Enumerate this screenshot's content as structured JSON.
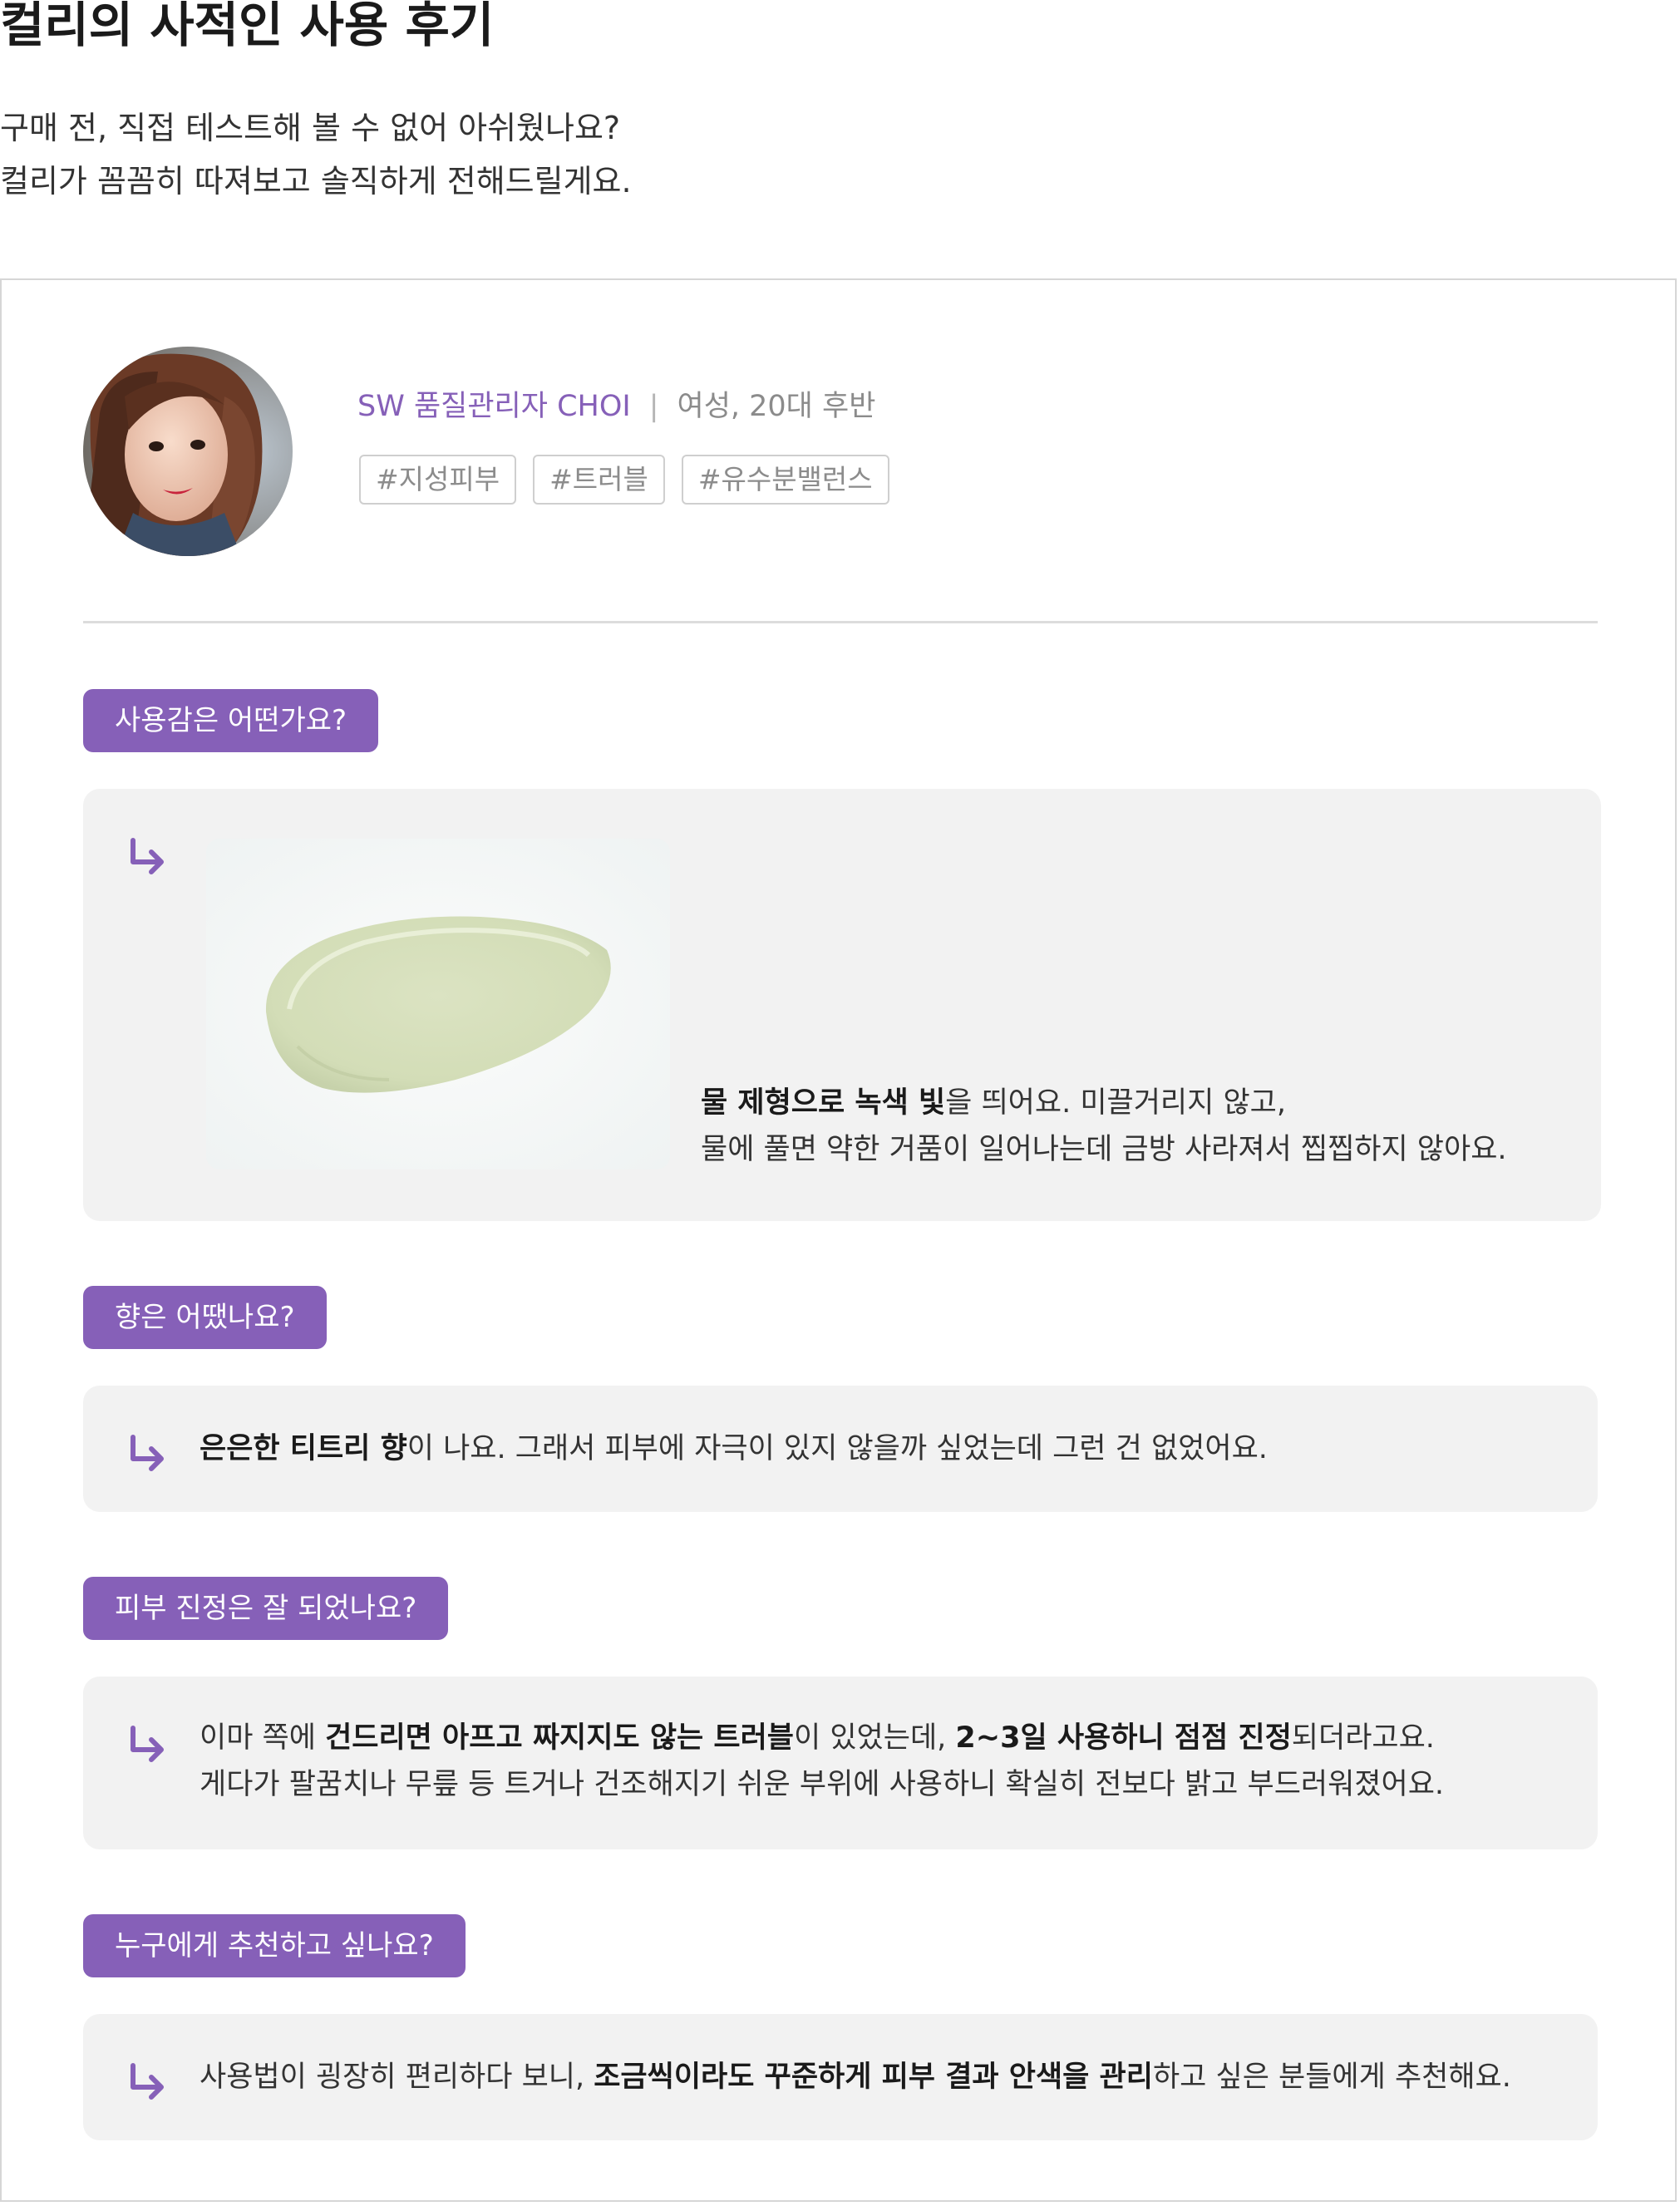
{
  "page": {
    "title": "컬리의 사적인 사용 후기",
    "intro_lines": [
      "구매 전, 직접 테스트해 볼 수 없어 아쉬웠나요?",
      "컬리가 꼼꼼히 따져보고 솔직하게 전해드릴게요."
    ]
  },
  "reviewer": {
    "role": "SW 품질관리자 CHOI",
    "separator": "|",
    "demographic": "여성, 20대 후반",
    "tags": [
      "#지성피부",
      "#트러블",
      "#유수분밸런스"
    ]
  },
  "colors": {
    "accent": "#8660b8",
    "answer_bg": "#f2f2f2",
    "border": "#d6d6d6"
  },
  "qa": [
    {
      "question": "사용감은 어떤가요?",
      "answer_lines": [
        [
          {
            "text": "물 제형으로 녹색 빛",
            "bold": true
          },
          {
            "text": "을 띄어요. 미끌거리지 않고,",
            "bold": false
          }
        ],
        [
          {
            "text": "물에 풀면 약한 거품이 일어나는데 금방 사라져서 찝찝하지 않아요.",
            "bold": false
          }
        ]
      ]
    },
    {
      "question": "향은 어땠나요?",
      "answer_lines": [
        [
          {
            "text": "은은한 티트리 향",
            "bold": true
          },
          {
            "text": "이 나요. 그래서 피부에 자극이 있지 않을까 싶었는데 그런 건 없었어요.",
            "bold": false
          }
        ]
      ]
    },
    {
      "question": "피부 진정은 잘 되었나요?",
      "answer_lines": [
        [
          {
            "text": "이마 쪽에 ",
            "bold": false
          },
          {
            "text": "건드리면 아프고 짜지지도 않는 트러블",
            "bold": true
          },
          {
            "text": "이 있었는데, ",
            "bold": false
          },
          {
            "text": "2~3일 사용하니 점점 진정",
            "bold": true
          },
          {
            "text": "되더라고요.",
            "bold": false
          }
        ],
        [
          {
            "text": "게다가 팔꿈치나 무릎 등 트거나 건조해지기 쉬운 부위에 사용하니 확실히 전보다 밝고 부드러워졌어요.",
            "bold": false
          }
        ]
      ]
    },
    {
      "question": "누구에게 추천하고 싶나요?",
      "answer_lines": [
        [
          {
            "text": "사용법이 굉장히 편리하다 보니, ",
            "bold": false
          },
          {
            "text": "조금씩이라도 꾸준하게 피부 결과 안색을 관리",
            "bold": true
          },
          {
            "text": "하고 싶은 분들에게 추천해요.",
            "bold": false
          }
        ]
      ]
    }
  ],
  "icons": {
    "answer_arrow": "turn-down-right-arrow-icon",
    "avatar": "reviewer-photo",
    "swatch": "product-texture-swatch"
  }
}
